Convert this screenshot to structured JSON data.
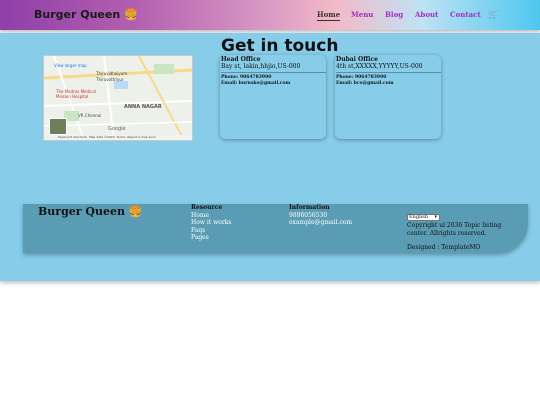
{
  "header": {
    "brand": "Burger Queen",
    "brand_icon": "burger-icon",
    "nav": [
      {
        "label": "Home",
        "active": true
      },
      {
        "label": "Menu",
        "active": false
      },
      {
        "label": "Blog",
        "active": false
      },
      {
        "label": "About",
        "active": false
      },
      {
        "label": "Contact",
        "active": false
      }
    ],
    "cart_icon": "cart-icon"
  },
  "map": {
    "larger_map_link": "View larger map",
    "labels": [
      "Thiruvidhaiyum",
      "Thiruvottriyur",
      "The Madras Medical",
      "Mission Hospital",
      "ANNA NAGAR",
      "VR Chennai",
      "Google"
    ],
    "footer": [
      "Keyboard shortcuts",
      "Map data ©2020",
      "Terms",
      "Report a map error"
    ],
    "zoom_in": "+",
    "zoom_out": "−"
  },
  "contact": {
    "title": "Get in touch",
    "offices": [
      {
        "name": "Head Office",
        "address": "Bay st, lakin,hhjio,US-000",
        "phone": "Phone: 9064783900",
        "email": "Email: burnsko@gmail.com"
      },
      {
        "name": "Dubai Office",
        "address": "4th st,XXXXX,YYYYY,US-000",
        "phone": "Phone: 9064783900",
        "email": "Email: bco@gmail.com"
      }
    ]
  },
  "footer": {
    "brand": "Burger Queen",
    "resource": {
      "heading": "Resource",
      "links": [
        "Home",
        "How it works",
        "Faqs",
        "Pages"
      ]
    },
    "information": {
      "heading": "Information",
      "phone": "9896056530",
      "email": "example@gmail.com"
    },
    "language": "English",
    "copyright": "Copyright ul 2036 Topic listing center. Allrights reserved.",
    "designed": "Designed : TemplateMO"
  },
  "colors": {
    "accent": "#a12fbd",
    "main_bg": "#87cdea",
    "footer_bg": "#5b9cb5"
  }
}
